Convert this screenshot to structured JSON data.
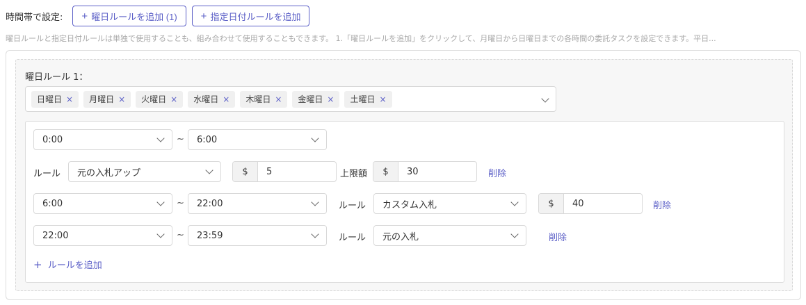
{
  "header": {
    "label": "時間帯で設定:",
    "add_weekday_rule": "曜日ルールを追加 (1)",
    "add_date_rule": "指定日付ルールを追加",
    "plus_glyph": "+"
  },
  "description": "曜日ルールと指定日付ルールは単独で使用することも、組み合わせて使用することもできます。 1.「曜日ルールを追加」をクリックして、月曜日から日曜日までの各時間の委託タスクを設定できます。平日...",
  "weekday_rule": {
    "title": "曜日ルール 1：",
    "days": [
      "日曜日",
      "月曜日",
      "火曜日",
      "水曜日",
      "木曜日",
      "金曜日",
      "土曜日"
    ],
    "remove_glyph": "×"
  },
  "labels": {
    "tilde": "~",
    "rule": "ルール",
    "upper_limit": "上限額",
    "currency": "$",
    "delete": "削除",
    "add_rule": "ルールを追加"
  },
  "slots": [
    {
      "start": "0:00",
      "end": "6:00",
      "rule": "元の入札アップ",
      "amount": "5",
      "limit": "30"
    },
    {
      "start": "6:00",
      "end": "22:00",
      "rule": "カスタム入札",
      "amount": "40"
    },
    {
      "start": "22:00",
      "end": "23:59",
      "rule": "元の入札"
    }
  ],
  "colors": {
    "accent": "#5b5fc7",
    "muted_text": "#a8a8a8"
  }
}
